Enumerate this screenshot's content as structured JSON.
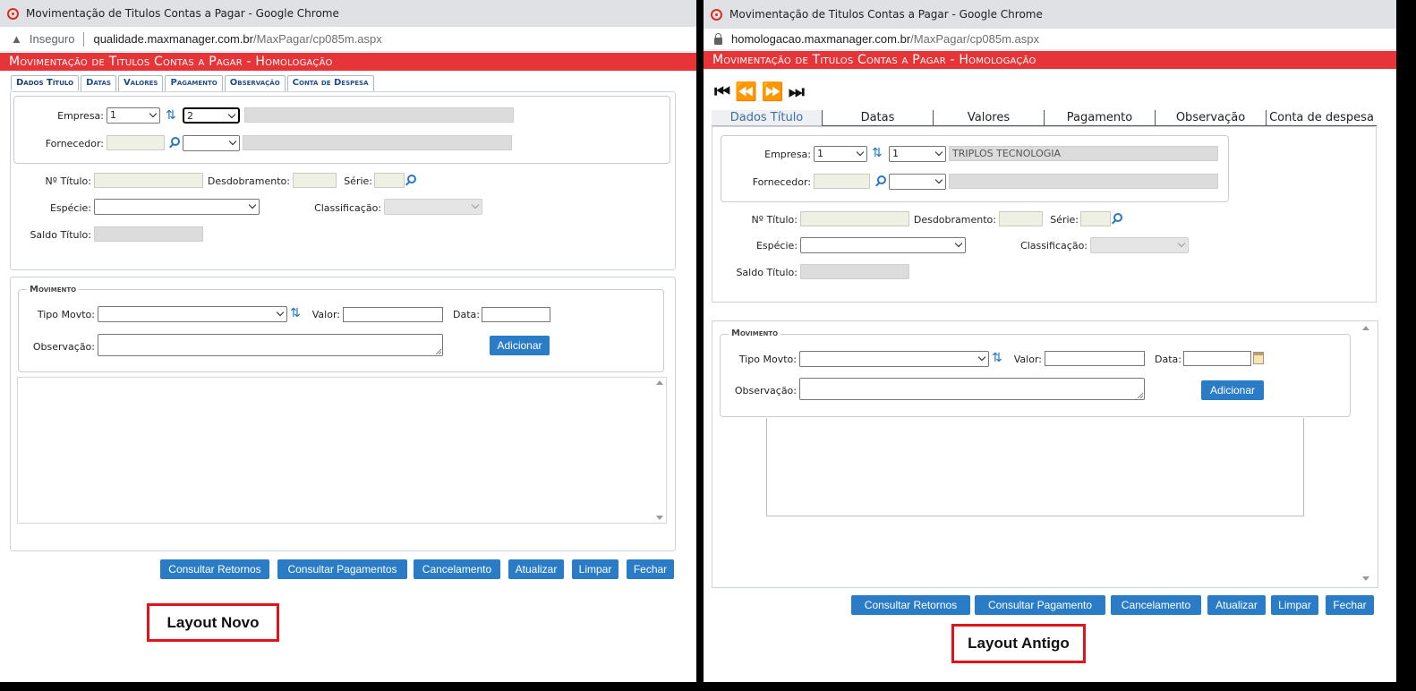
{
  "left": {
    "browser": {
      "title": "Movimentação de Titulos Contas a Pagar - Google Chrome",
      "security_label": "Inseguro",
      "url_host": "qualidade.maxmanager.com.br",
      "url_path": "/MaxPagar/cp085m.aspx"
    },
    "header": {
      "title": "Movimentação de Titulos Contas a Pagar  - Homologação"
    },
    "tabs": [
      "Dados Título",
      "Datas",
      "Valores",
      "Pagamento",
      "Observação",
      "Conta de Despesa"
    ],
    "form": {
      "empresa_label": "Empresa:",
      "empresa_value": "1",
      "empresa2_value": "2",
      "fornecedor_label": "Fornecedor:",
      "numero_label": "Nº Título:",
      "desdobramento_label": "Desdobramento:",
      "serie_label": "Série:",
      "especie_label": "Espécie:",
      "classificacao_label": "Classificação:",
      "saldo_label": "Saldo Título:"
    },
    "movimento": {
      "legend": "Movimento",
      "tipo_label": "Tipo Movto:",
      "valor_label": "Valor:",
      "data_label": "Data:",
      "obs_label": "Observação:",
      "add_button": "Adicionar"
    },
    "buttons": [
      "Consultar Retornos",
      "Consultar Pagamentos",
      "Cancelamento",
      "Atualizar",
      "Limpar",
      "Fechar"
    ],
    "caption": "Layout Novo"
  },
  "right": {
    "browser": {
      "title": "Movimentação de Titulos Contas a Pagar - Google Chrome",
      "url_host": "homologacao.maxmanager.com.br",
      "url_path": "/MaxPagar/cp085m.aspx"
    },
    "header": {
      "title": "Movimentação de Titulos Contas a Pagar  - Homologação"
    },
    "nav": {
      "first": "⏮",
      "prev": "⏪",
      "next": "⏩",
      "last": "⏭"
    },
    "tabs": [
      "Dados Título",
      "Datas",
      "Valores",
      "Pagamento",
      "Observação",
      "Conta de despesa"
    ],
    "form": {
      "empresa_label": "Empresa:",
      "empresa_value": "1",
      "empresa2_value": "1",
      "empresa_name": "TRIPLOS TECNOLOGIA",
      "fornecedor_label": "Fornecedor:",
      "numero_label": "Nº Título:",
      "desdobramento_label": "Desdobramento:",
      "serie_label": "Série:",
      "especie_label": "Espécie:",
      "classificacao_label": "Classificação:",
      "saldo_label": "Saldo Título:"
    },
    "movimento": {
      "legend": "Movimento",
      "tipo_label": "Tipo Movto:",
      "valor_label": "Valor:",
      "data_label": "Data:",
      "obs_label": "Observação:",
      "add_button": "Adicionar"
    },
    "buttons": [
      "Consultar Retornos",
      "Consultar Pagamento",
      "Cancelamento",
      "Atualizar",
      "Limpar",
      "Fechar"
    ],
    "caption": "Layout Antigo"
  },
  "colors": {
    "header_red": "#e63438",
    "button_blue": "#2b7cc6",
    "caption_red": "#e1141c"
  }
}
